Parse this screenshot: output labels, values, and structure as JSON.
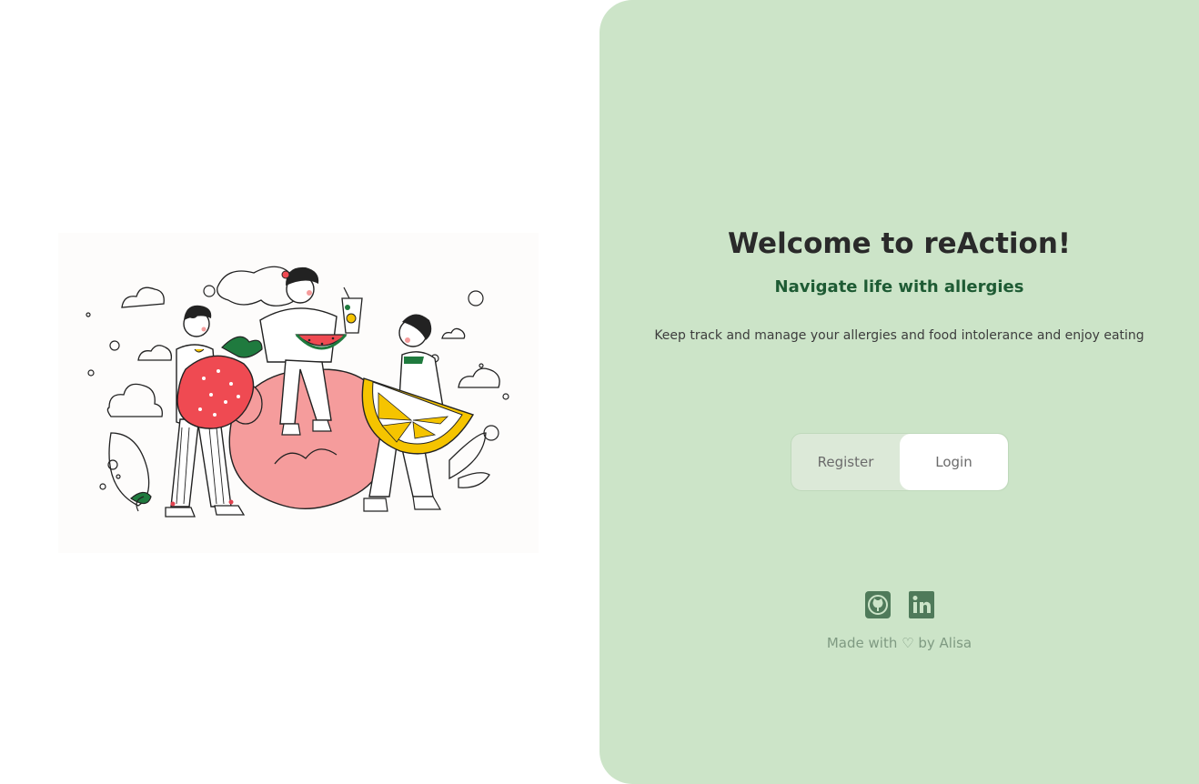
{
  "hero": {
    "title": "Welcome to reAction!",
    "subtitle": "Navigate life with allergies",
    "description": "Keep track and manage your allergies and food intolerance and enjoy eating"
  },
  "auth_toggle": {
    "register_label": "Register",
    "login_label": "Login",
    "active": "Login"
  },
  "socials": [
    "github-icon",
    "linkedin-icon"
  ],
  "footer": {
    "prefix": "Made with",
    "heart": "♡",
    "suffix": "by Alisa"
  },
  "colors": {
    "panel_bg": "#cce4c8",
    "accent_green": "#1e5b34",
    "icon_color": "#4f7a5a"
  }
}
